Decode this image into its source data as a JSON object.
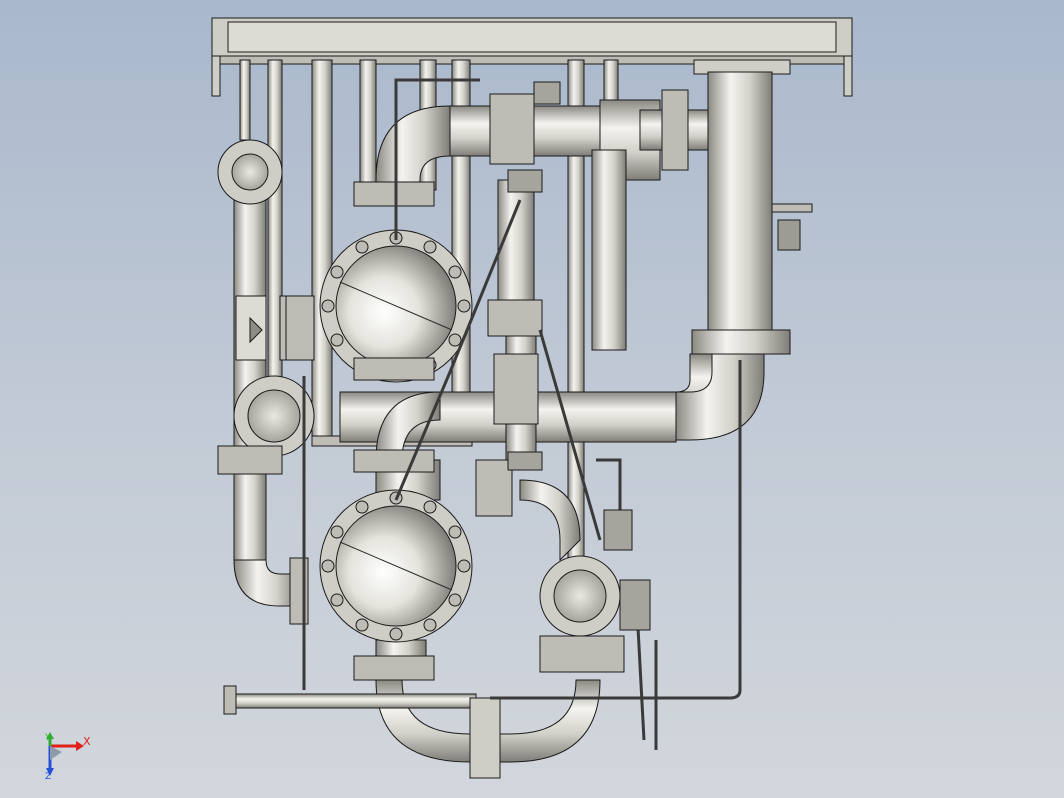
{
  "viewport": {
    "background_top": "#a9b8cc",
    "background_bottom": "#d2d6dc"
  },
  "model": {
    "description_icon": "piping-skid-assembly",
    "pipe_color": "#c8c7bf",
    "pipe_highlight": "#f4f3ee",
    "pipe_shadow": "#7e7d77",
    "outline_color": "#1a1a1a",
    "frame_color": "#cfcec6"
  },
  "triad": {
    "x": {
      "label": "X",
      "color": "#e0201b"
    },
    "y": {
      "label": "Y",
      "color": "#2fae2f"
    },
    "z": {
      "label": "Z",
      "color": "#2450d8"
    }
  }
}
